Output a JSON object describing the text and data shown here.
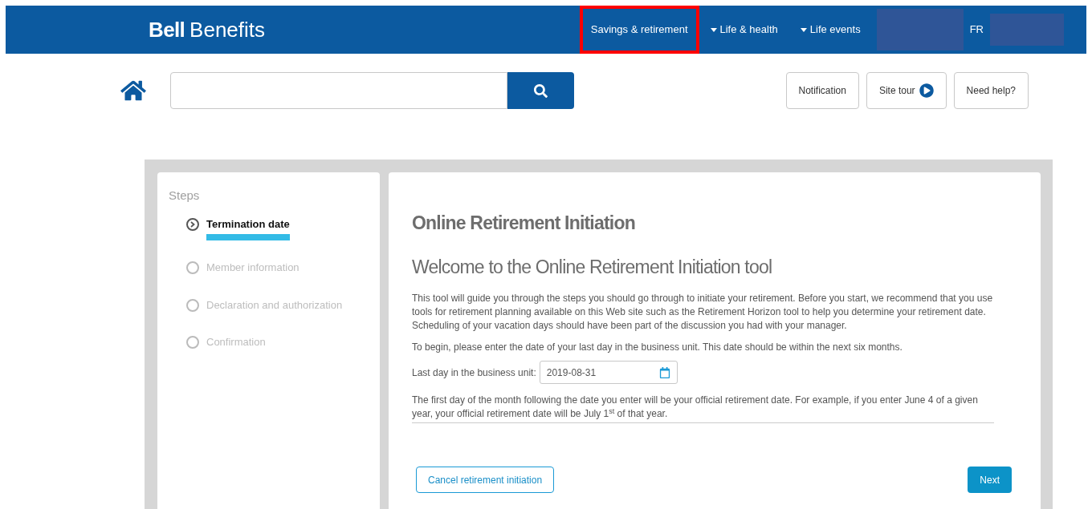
{
  "header": {
    "logo_bold": "Bell",
    "logo_text": "Benefits",
    "nav": [
      {
        "label": "Savings & retirement",
        "selected": true,
        "caret": false
      },
      {
        "label": "Life & health",
        "selected": false,
        "caret": true
      },
      {
        "label": "Life events",
        "selected": false,
        "caret": true
      }
    ],
    "language": "FR"
  },
  "toolbar": {
    "buttons": [
      {
        "label": "Notification",
        "kind": "plain"
      },
      {
        "label": "Site tour",
        "kind": "play"
      },
      {
        "label": "Need help?",
        "kind": "plain"
      }
    ]
  },
  "steps": {
    "title": "Steps",
    "items": [
      {
        "label": "Termination date",
        "selected": true
      },
      {
        "label": "Member information",
        "selected": false
      },
      {
        "label": "Declaration and authorization",
        "selected": false
      },
      {
        "label": "Confirmation",
        "selected": false
      }
    ]
  },
  "main": {
    "title": "Online Retirement Initiation",
    "subtitle": "Welcome to the Online Retirement Initiation tool",
    "intro": "This tool will guide you through the steps you should go through to initiate your retirement. Before you start, we recommend that you use tools for retirement planning available on this Web site such as the Retirement Horizon tool to help you determine your retirement date. Scheduling of your vacation days should have been part of the discussion you had with your manager.",
    "instruction": "To begin, please enter the date of your last day in the business unit. This date should be within the next six months.",
    "date_label": "Last day in the business unit:",
    "date_value": "2019-08-31",
    "note": "The first day of the month following the date you enter will be your official retirement date. For example, if you enter June 4 of a given year, your official retirement date will be July 1$^{st}$ of that year.",
    "cancel": "Cancel retirement initiation",
    "next": "Next"
  }
}
